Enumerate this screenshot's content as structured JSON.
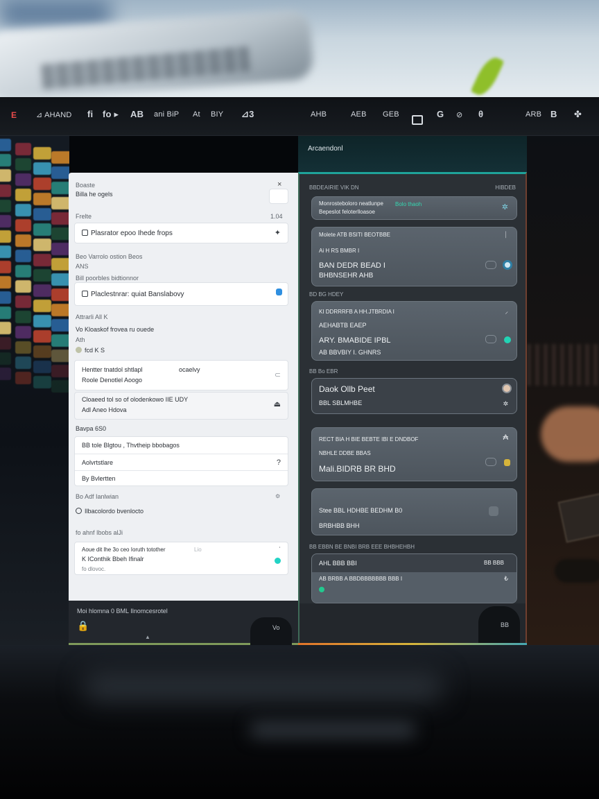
{
  "menubar": {
    "items_left": [
      "E",
      "⊿ AHAND",
      "fi",
      "fo ▸",
      "AB",
      "ani BiP",
      "At",
      "BIY",
      "⊿3"
    ],
    "items_right": [
      "AHB",
      "AEB",
      "GEB",
      "G",
      "⊘",
      "θ",
      "ARB",
      "B",
      "✤"
    ]
  },
  "left_panel": {
    "header_label": "Boaste",
    "header_sub": "Billa he ogels",
    "close": "×",
    "section1_label": "Frelte",
    "section1_right": "1.04",
    "card1_text": "Plasrator epoo Ihede frops",
    "section2_label": "Beo Varrolo ostion Beos",
    "section2_sub": "ANS",
    "section2_sub2": "Bill poorbles bidtionnor",
    "card2_text": "Placlestnrar: quiat Banslabovy",
    "section3_label": "Attrarli All K",
    "section3_line1": "Vo Kloaskof frovea ru ouede",
    "section3_line2": "Ath",
    "section3_line3": "fcd K S",
    "card3_text1": "Hentter tnatdol shtlapl",
    "card3_text1b": "ocaelvy",
    "card3_text2": "Roole Denotlel Aoogo",
    "card4_text1": "Cloaeed tol so of olodenkowo IIE UDY",
    "card4_text2": "Adl Aneo Hdova",
    "section4_label": "Bavpa 6S0",
    "row1": "BB tole Blgtou , Thvtheip bbobagos",
    "row2": "Aolvrtstlare",
    "row2_right": "?",
    "row3": "By Bvlertten",
    "section5_label": "Bo Adf Ianlwian",
    "section5_line": "Ilbacolordo bvenlocto",
    "section6_label": "fo ahnf Ibobs alJi",
    "card5_line1": "Aoue dit lhe 3o ceo Ioruth totother",
    "card5_line1b": "Lio",
    "card5_line2": "K IConthik Bbeh Ifinalr",
    "card5_line3": "fo dlovoc."
  },
  "left_footer": {
    "text": "Moi hlomna 0 BML Ilnomcesrotel",
    "blob_text": "Vo"
  },
  "right_panel": {
    "header_title": "Arcaendonl",
    "section1_label": "BBDEAIRIE VIK DN",
    "section1_right": "HIBDEB",
    "card1_line1": "Monrosteboloro neatlunpe",
    "card1_line2": "Bepeslot feloterlloasoe",
    "card1_green": "Bolo thaoh",
    "card2_line1": "Molete ATB BSITI BEOTBBE",
    "card2_line2": "Ai H RS BMBR I",
    "card2_line3": "BAN DEDR BEAD I",
    "card2_line4": "BHBNSEHR AHB",
    "section2_label": "BD BG HDEY",
    "card3_line1": "KI DDRRRFB A HH.JTBRDIA I",
    "card3_line2": "AEHABTB EAEP",
    "card3_line3": "ARY. BMABIDE IPBL",
    "card3_line4": "AB BBVBIY I. GHNRS",
    "section3_label": "BB Bo EBR",
    "card4_line1": "Daok Ollb Peet",
    "card4_line2": "BBL SBLMHBE",
    "section4_label": "",
    "card5_line1": "RECT BIA H BIE BEBTE IBI E DNDBOF",
    "card5_line2": "NBHLE DDBE BBAS",
    "card5_line3": "Mali.BIDRB BR BHD",
    "card6_line1": "Stee BBL HDHBE BEDHM B0",
    "card6_line2": "BRBHBB BHH",
    "section5_label": "BB EBBN BE BNBI BRB EEE BHBHEHBH",
    "card7_line1": "AHL BBB BBI",
    "card7_right": "BB BBB",
    "card7_line2": "AB BRBB A BBDBBBBBBB BBB I",
    "footer_text": "BB"
  },
  "colors": {
    "accent_teal": "#1fa39a",
    "accent_green_text": "#36d6b1",
    "status_cyan": "#22d3c5",
    "status_blue": "#2f8fe0",
    "status_orange": "#e2742a",
    "status_yellow": "#d6b43b"
  }
}
